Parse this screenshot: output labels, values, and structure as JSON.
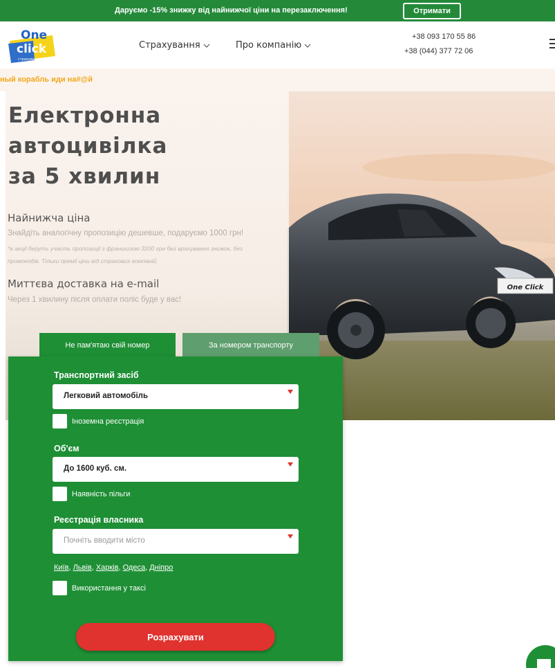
{
  "promo": {
    "text": "Даруємо -15% знижку від найнижчої ціни на перезаключення!",
    "button": "Отримати"
  },
  "header": {
    "logo": {
      "line1": "One",
      "line2": "click",
      "line3": "страхування"
    },
    "nav": [
      {
        "label": "Страхування"
      },
      {
        "label": "Про компанію"
      }
    ],
    "phones": [
      "+38 093 170 55 86",
      "+38 (044) 377 72 06"
    ],
    "menu_icon": "hamburger-icon"
  },
  "ticker": {
    "text": "ный корабль иди на#@й"
  },
  "hero": {
    "title_lines": [
      "Електронна",
      "автоцивілка",
      "за 5 хвилин"
    ],
    "feature1": {
      "heading": "Найнижча ціна",
      "text": "Знайдіть аналогічну пропозицію дешевше, подаруємо 1000 грн!",
      "note_line1": "*в акції беруть участь пропозиції з франшизою 3200 грн без врахування знижок, без",
      "note_line2": "промокодів. Тільки премії ціни від страхових компаній."
    },
    "feature2": {
      "heading": "Миттєва доставка на e-mail",
      "text": "Через 1 хвилину після оплати поліс буде у вас!"
    },
    "plate_text": "One Click"
  },
  "tabs": [
    {
      "label": "Не пам'ятаю свій номер",
      "active": true
    },
    {
      "label": "За номером транспорту",
      "active": false
    }
  ],
  "form": {
    "vehicle": {
      "label": "Транспортний засіб",
      "value": "Легковий автомобіль"
    },
    "foreign_reg": {
      "label": "Іноземна реєстрація",
      "checked": false
    },
    "volume": {
      "label": "Об'єм",
      "value": "До 1600 куб. см."
    },
    "benefit": {
      "label": "Наявність пільги",
      "checked": false
    },
    "registration": {
      "label": "Реєстрація власника",
      "placeholder": "Почніть вводити місто"
    },
    "cities": [
      "Київ",
      "Львів",
      "Харків",
      "Одеса",
      "Дніпро"
    ],
    "taxi": {
      "label": "Використання у таксі",
      "checked": false
    },
    "submit": "Розрахувати"
  },
  "colors": {
    "brand_green": "#1e8f35",
    "promo_green": "#248a3a",
    "tab_inactive": "#5f9e6e",
    "cta_red": "#e0322f",
    "ticker_yellow": "#f2a71b",
    "required_red": "#e0322f"
  },
  "chat_icon": "chat-bubble-icon"
}
